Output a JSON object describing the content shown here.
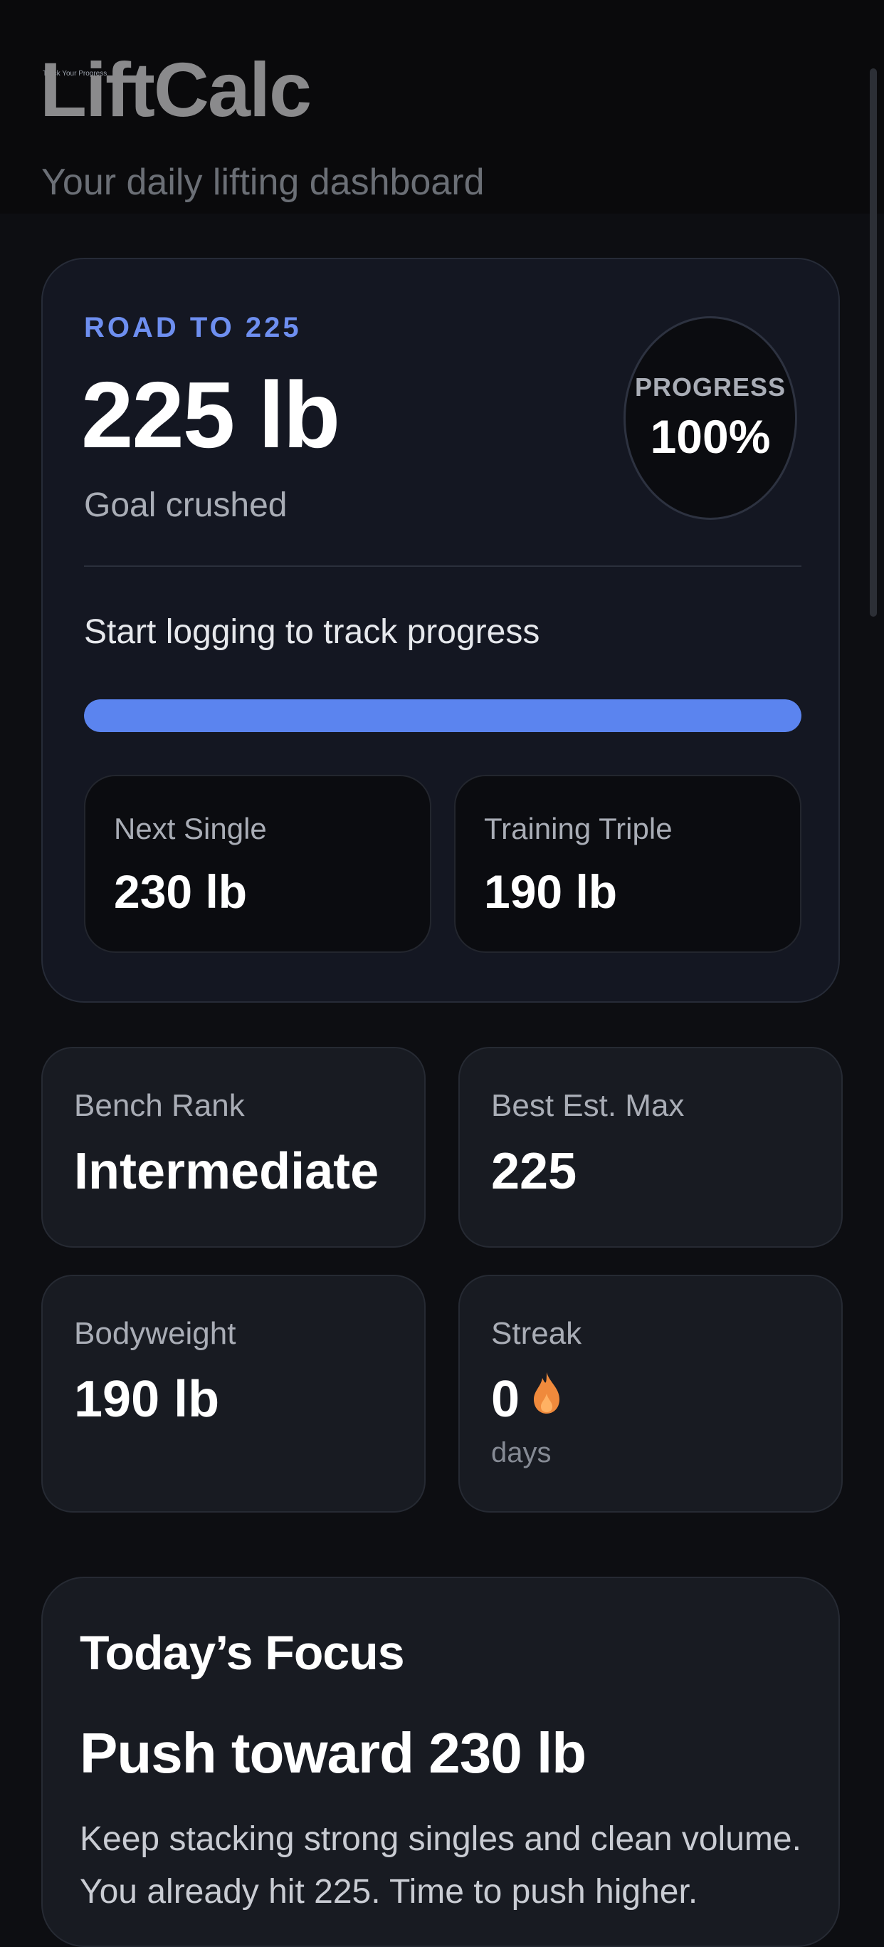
{
  "header": {
    "tagline": "Track Your Progress",
    "app_name": "LiftCalc",
    "subtitle": "Your daily lifting dashboard"
  },
  "goal_card": {
    "eyebrow": "ROAD TO 225",
    "goal_weight": "225 lb",
    "status": "Goal crushed",
    "progress_label": "PROGRESS",
    "progress_value": "100%",
    "progress_fraction": 1.0,
    "tracking_message": "Start logging to track progress",
    "next_single": {
      "label": "Next Single",
      "value": "230 lb"
    },
    "training_triple": {
      "label": "Training Triple",
      "value": "190 lb"
    }
  },
  "stats": {
    "bench_rank": {
      "label": "Bench Rank",
      "value": "Intermediate"
    },
    "best_est_max": {
      "label": "Best Est. Max",
      "value": "225"
    },
    "bodyweight": {
      "label": "Bodyweight",
      "value": "190 lb"
    },
    "streak": {
      "label": "Streak",
      "value": "0",
      "unit": "days",
      "icon": "flame-icon"
    }
  },
  "focus": {
    "heading": "Today’s Focus",
    "title": "Push toward 230 lb",
    "body": "Keep stacking strong singles and clean volume. You already hit 225. Time to push higher."
  },
  "colors": {
    "accent": "#5b84ef",
    "eyebrow": "#6e8ff0",
    "flame": "#f08a3c",
    "background": "#0d0e12",
    "card": "#141722"
  }
}
